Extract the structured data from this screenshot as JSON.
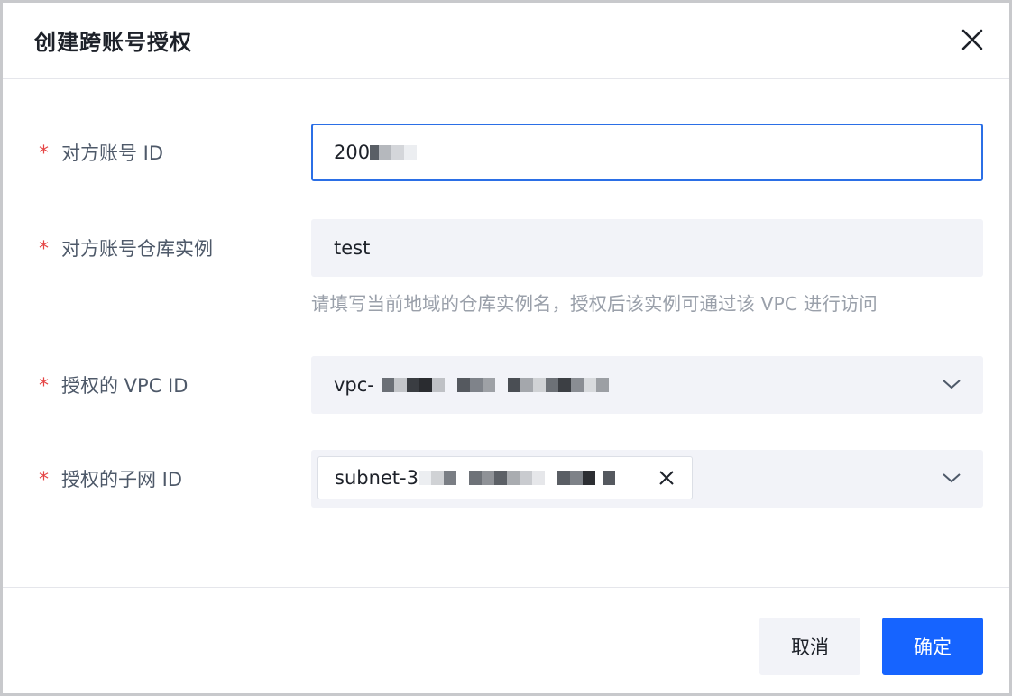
{
  "dialog": {
    "title": "创建跨账号授权"
  },
  "form": {
    "account_id": {
      "required_mark": "*",
      "label": "对方账号 ID",
      "value": "200"
    },
    "instance": {
      "required_mark": "*",
      "label": "对方账号仓库实例",
      "value": "test",
      "hint": "请填写当前地域的仓库实例名，授权后该实例可通过该 VPC 进行访问"
    },
    "vpc": {
      "required_mark": "*",
      "label": "授权的 VPC ID",
      "value": "vpc-"
    },
    "subnet": {
      "required_mark": "*",
      "label": "授权的子网 ID",
      "tag_value": "subnet-3"
    }
  },
  "footer": {
    "cancel_label": "取消",
    "ok_label": "确定"
  },
  "icons": {
    "close": "close-icon",
    "chevron": "chevron-down-icon"
  },
  "colors": {
    "primary": "#1664ff",
    "required": "#e54545",
    "focus_border": "#2b6fe6"
  }
}
